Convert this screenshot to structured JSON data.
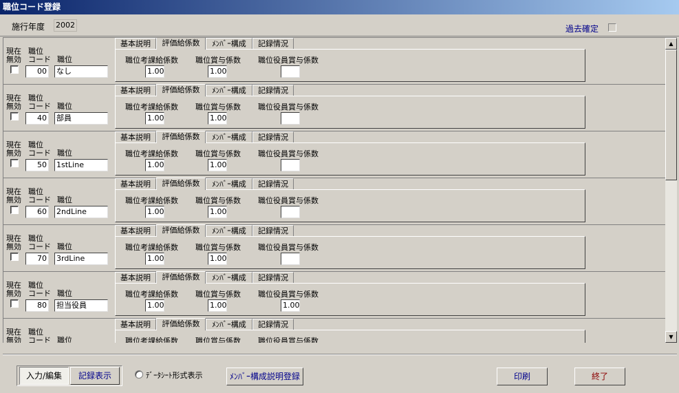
{
  "window": {
    "title": "職位コード登録"
  },
  "top": {
    "year_label": "施行年度",
    "year_value": "2002",
    "past_confirm_label": "過去確定"
  },
  "row_labels": {
    "current": "現在",
    "invalid": "無効",
    "pos_code_1": "職位",
    "pos_code_2": "コード",
    "position": "職位"
  },
  "tabs": [
    "基本説明",
    "評価給係数",
    "ﾒﾝﾊﾞｰ構成",
    "記録情況"
  ],
  "panel_labels": [
    "職位考課給係数",
    "職位賞与係数",
    "職位役員賞与係数"
  ],
  "records": [
    {
      "code": "00",
      "position": "なし",
      "coef1": "1.00",
      "coef2": "1.00",
      "coef3": ""
    },
    {
      "code": "40",
      "position": "部員",
      "coef1": "1.00",
      "coef2": "1.00",
      "coef3": ""
    },
    {
      "code": "50",
      "position": "1stLine",
      "coef1": "1.00",
      "coef2": "1.00",
      "coef3": ""
    },
    {
      "code": "60",
      "position": "2ndLine",
      "coef1": "1.00",
      "coef2": "1.00",
      "coef3": ""
    },
    {
      "code": "70",
      "position": "3rdLine",
      "coef1": "1.00",
      "coef2": "1.00",
      "coef3": ""
    },
    {
      "code": "80",
      "position": "担当役員",
      "coef1": "1.00",
      "coef2": "1.00",
      "coef3": "1.00"
    },
    {
      "code": "",
      "position": "",
      "coef1": "",
      "coef2": "",
      "coef3": ""
    }
  ],
  "footer": {
    "input_edit": "入力/編集",
    "record_view": "記録表示",
    "datasheet_label": "ﾃﾞｰﾀｼｰﾄ形式表示",
    "member_register": "ﾒﾝﾊﾞｰ構成説明登録",
    "print": "印刷",
    "exit": "終了"
  },
  "colors": {
    "titlebar_start": "#0a246a",
    "titlebar_end": "#a6caf0",
    "past_label": "#00008b",
    "exit_text": "#8b0000",
    "face": "#d4d0c8"
  }
}
